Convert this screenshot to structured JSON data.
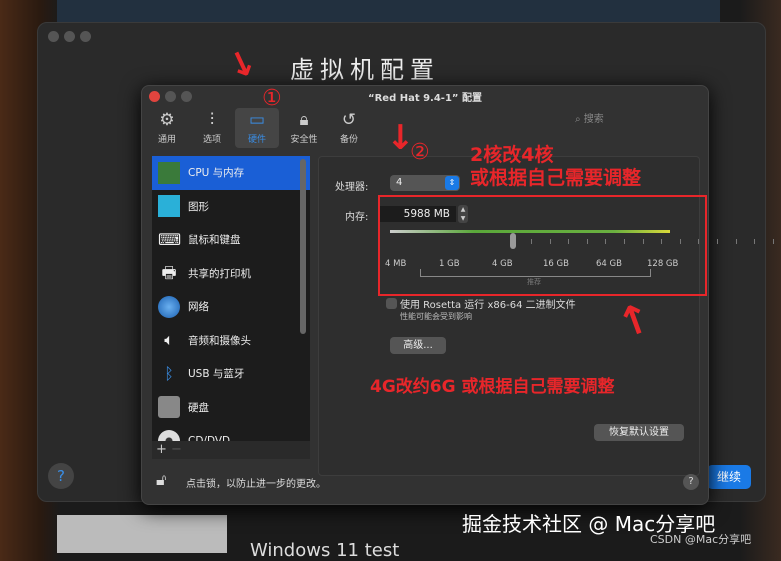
{
  "background_window": {
    "title": "虚拟机配置",
    "help": "?",
    "continue_label": "继续",
    "bottom_text": "Windows 11 test"
  },
  "dialog": {
    "title": "“Red Hat 9.4-1” 配置",
    "toolbar": [
      {
        "label": "通用",
        "icon": "gear-icon"
      },
      {
        "label": "选项",
        "icon": "sliders-icon"
      },
      {
        "label": "硬件",
        "icon": "display-icon"
      },
      {
        "label": "安全性",
        "icon": "lock-icon"
      },
      {
        "label": "备份",
        "icon": "clock-icon"
      }
    ],
    "search_placeholder": "搜索",
    "sidebar": [
      {
        "label": "CPU 与内存",
        "icon": "cpu-icon"
      },
      {
        "label": "图形",
        "icon": "monitor-icon"
      },
      {
        "label": "鼠标和键盘",
        "icon": "keyboard-icon"
      },
      {
        "label": "共享的打印机",
        "icon": "printer-icon"
      },
      {
        "label": "网络",
        "icon": "globe-icon"
      },
      {
        "label": "音频和摄像头",
        "icon": "camera-icon"
      },
      {
        "label": "USB 与蓝牙",
        "icon": "usb-icon"
      },
      {
        "label": "硬盘",
        "icon": "disk-icon"
      },
      {
        "label": "CD/DVD",
        "icon": "cd-icon"
      }
    ],
    "add": "+",
    "remove": "−",
    "cpu_label": "处理器:",
    "cpu_value": "4",
    "mem_label": "内存:",
    "mem_value": "5988 MB",
    "slider_ticks": [
      "4 MB",
      "1 GB",
      "4 GB",
      "16 GB",
      "64 GB",
      "128 GB"
    ],
    "recommended": "推荐",
    "rosetta": "使用 Rosetta 运行 x86-64 二进制文件",
    "rosetta_sub": "性能可能会受到影响",
    "advanced": "高级...",
    "restore": "恢复默认设置",
    "lock_text": "点击锁，以防止进一步的更改。",
    "help": "?"
  },
  "annotations": {
    "step1": "①",
    "step2": "②",
    "cpu_note_1": "2核改4核",
    "cpu_note_2": "或根据自己需要调整",
    "mem_note": "4G改约6G  或根据自己需要调整"
  },
  "watermark": {
    "main": "掘金技术社区 @ Mac分享吧",
    "sub": "CSDN @Mac分享吧"
  },
  "colors": {
    "accent": "#1a7ae6",
    "annotation": "#e8262a",
    "selected": "#1a5fd6"
  }
}
